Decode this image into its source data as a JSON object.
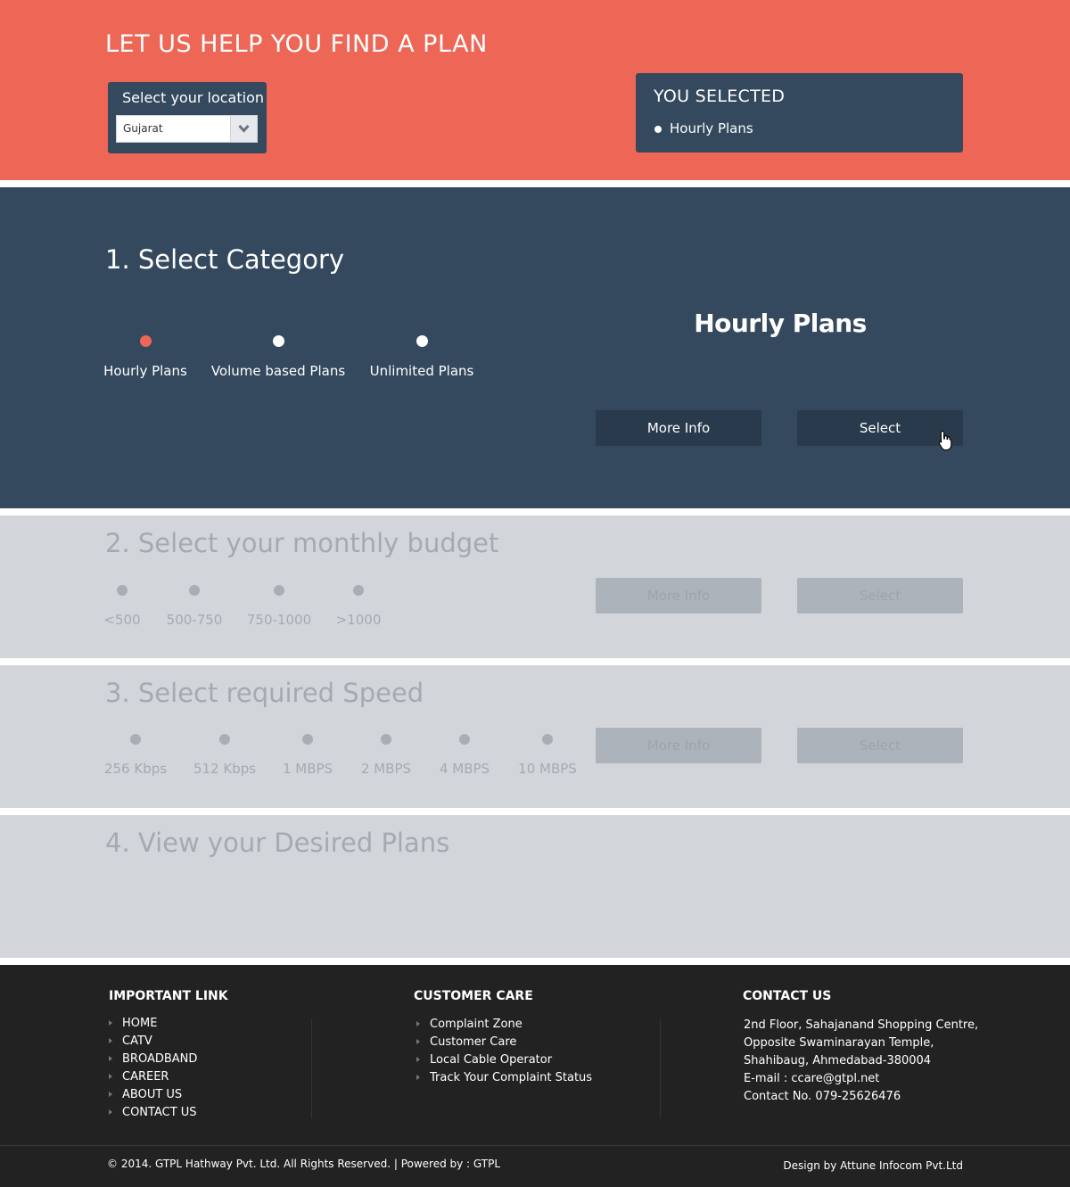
{
  "header": {
    "title": "LET US HELP YOU FIND A PLAN",
    "location_label": "Select your location",
    "location_value": "Gujarat",
    "selected_title": "YOU SELECTED",
    "selected_item": "Hourly Plans"
  },
  "category": {
    "title": "1. Select Category",
    "options": [
      "Hourly Plans",
      "Volume based Plans",
      "Unlimited Plans"
    ],
    "active_index": 0,
    "current_label": "Hourly Plans",
    "more_info": "More Info",
    "select": "Select"
  },
  "budget": {
    "title": "2. Select your monthly budget",
    "options": [
      "<500",
      "500-750",
      "750-1000",
      ">1000"
    ],
    "more_info": "More Info",
    "select": "Select"
  },
  "speed": {
    "title": "3. Select required Speed",
    "options": [
      "256 Kbps",
      "512 Kbps",
      "1 MBPS",
      "2 MBPS",
      "4 MBPS",
      "10 MBPS"
    ],
    "more_info": "More Info",
    "select": "Select"
  },
  "plans": {
    "title": "4. View your Desired Plans"
  },
  "footer": {
    "important_title": "IMPORTANT LINK",
    "important_links": [
      "HOME",
      "CATV",
      "BROADBAND",
      "CAREER",
      "ABOUT US",
      "CONTACT US"
    ],
    "care_title": "CUSTOMER CARE",
    "care_links": [
      "Complaint Zone",
      "Customer Care",
      "Local Cable Operator",
      "Track Your Complaint Status"
    ],
    "contact_title": "CONTACT US",
    "contact_lines": [
      "2nd Floor, Sahajanand Shopping Centre,",
      "Opposite Swaminarayan Temple,",
      "Shahibaug, Ahmedabad-380004",
      "E-mail :  ccare@gtpl.net",
      "Contact No. 079-25626476"
    ],
    "copyright": "© 2014. GTPL Hathway Pvt. Ltd. All Rights Reserved. | Powered by : GTPL",
    "design_credit": "Design by Attune Infocom Pvt.Ltd"
  },
  "colors": {
    "accent": "#ee6655",
    "navy": "#34495e",
    "button_dark": "#283a4c",
    "disabled_bg": "#d2d6da",
    "footer_bg": "#222222"
  }
}
